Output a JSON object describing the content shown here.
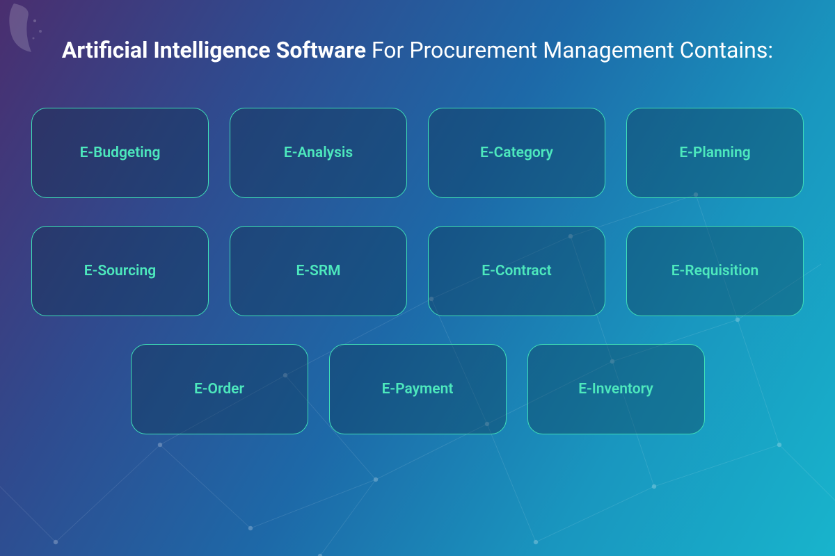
{
  "title": {
    "bold": "Artificial Intelligence Software",
    "rest": " For Procurement Management Contains:"
  },
  "rows": [
    [
      "E-Budgeting",
      "E-Analysis",
      "E-Category",
      "E-Planning"
    ],
    [
      "E-Sourcing",
      "E-SRM",
      "E-Contract",
      "E-Requisition"
    ],
    [
      "E-Order",
      "E-Payment",
      "E-Inventory"
    ]
  ]
}
